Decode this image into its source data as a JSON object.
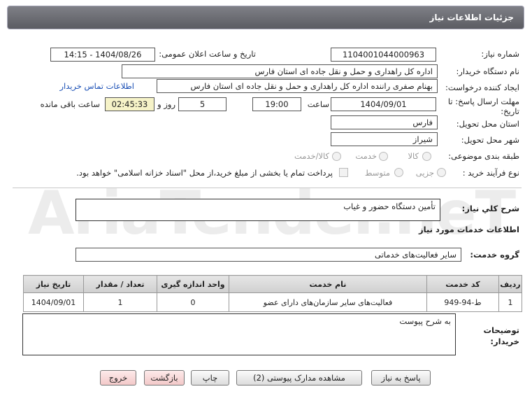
{
  "header": {
    "title": "جزئیات اطلاعات نیاز"
  },
  "form": {
    "need_number_label": "شماره نیاز:",
    "need_number": "1104001044000963",
    "announce_label": "تاریخ و ساعت اعلان عمومی:",
    "announce_value": "1404/08/26 - 14:15",
    "buyer_org_label": "نام دستگاه خریدار:",
    "buyer_org": "اداره کل راهداری و حمل و نقل جاده ای استان فارس",
    "creator_label": "ایجاد کننده درخواست:",
    "creator": "بهنام صفری راننده اداره کل راهداری و حمل و نقل جاده ای استان فارس",
    "contact_link": "اطلاعات تماس خریدار",
    "deadline_label_1": "مهلت ارسال پاسخ: تا",
    "deadline_label_2": "تاریخ:",
    "deadline_date": "1404/09/01",
    "time_label": "ساعت",
    "deadline_time": "19:00",
    "days_value": "5",
    "days_label": "روز و",
    "remaining_time": "02:45:33",
    "remaining_label": "ساعت باقی مانده",
    "province_label": "استان محل تحویل:",
    "province": "فارس",
    "city_label": "شهر محل تحویل:",
    "city": "شیراز",
    "category_label": "طبقه بندی موضوعی:",
    "category_options": [
      "کالا",
      "خدمت",
      "کالا/خدمت"
    ],
    "purchase_type_label": "نوع فرآیند خرید :",
    "purchase_options": [
      "جزیی",
      "متوسط"
    ],
    "payment_note": "پرداخت تمام یا بخشی از مبلغ خرید،از محل \"اسناد خزانه اسلامی\" خواهد بود."
  },
  "summary": {
    "label": "شرح کلي نياز:",
    "value": "تأمین دستگاه حضور و غیاب"
  },
  "services": {
    "section_title": "اطلاعات خدمات مورد نیاز",
    "group_label": "گروه خدمت:",
    "group_value": "سایر فعالیت‌های خدماتی",
    "columns": [
      "ردیف",
      "کد خدمت",
      "نام خدمت",
      "واحد اندازه گیری",
      "تعداد / مقدار",
      "تاریخ نیاز"
    ],
    "rows": [
      [
        "1",
        "ط-94-949",
        "فعالیت‌های سایر سازمان‌های دارای عضو",
        "0",
        "1",
        "1404/09/01"
      ]
    ]
  },
  "notes": {
    "label_1": "توضیحات",
    "label_2": "خریدار:",
    "value": "به شرح پیوست"
  },
  "buttons": {
    "reply": "پاسخ به نیاز",
    "attachments": "مشاهده مدارک پیوستی (2)",
    "print": "چاپ",
    "back": "بازگشت",
    "exit": "خروج"
  },
  "watermark": "AriaTender.neT"
}
